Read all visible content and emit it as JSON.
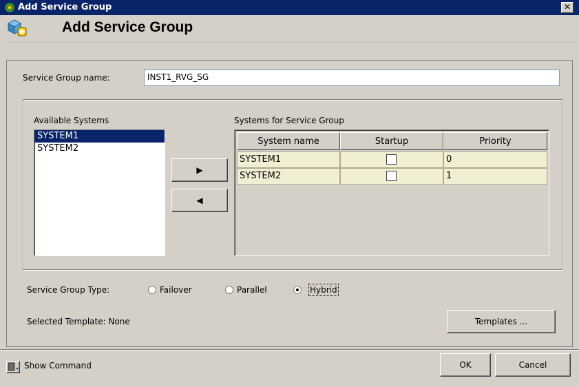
{
  "window": {
    "title": "Add Service Group",
    "close_glyph": "✕"
  },
  "header": {
    "title": "Add Service Group"
  },
  "form": {
    "name_label": "Service Group name:",
    "name_value": "INST1_RVG_SG"
  },
  "available": {
    "label": "Available Systems",
    "items": [
      "SYSTEM1",
      "SYSTEM2"
    ],
    "selected_index": 0
  },
  "transfer": {
    "add_glyph": "▶",
    "remove_glyph": "◀"
  },
  "assigned": {
    "label": "Systems for Service Group",
    "columns": [
      "System name",
      "Startup",
      "Priority"
    ],
    "rows": [
      {
        "system": "SYSTEM1",
        "startup": false,
        "priority": "0"
      },
      {
        "system": "SYSTEM2",
        "startup": false,
        "priority": "1"
      }
    ]
  },
  "type": {
    "label": "Service Group Type:",
    "options": [
      "Failover",
      "Parallel",
      "Hybrid"
    ],
    "selected": "Hybrid"
  },
  "template": {
    "label": "Selected Template: None",
    "button": "Templates ..."
  },
  "footer": {
    "show_command": "Show Command",
    "ok": "OK",
    "cancel": "Cancel"
  },
  "colors": {
    "titlebar": "#0a246a",
    "selection": "#0a246a",
    "table_row": "#f1efd3",
    "dialog": "#d4d0c8"
  }
}
